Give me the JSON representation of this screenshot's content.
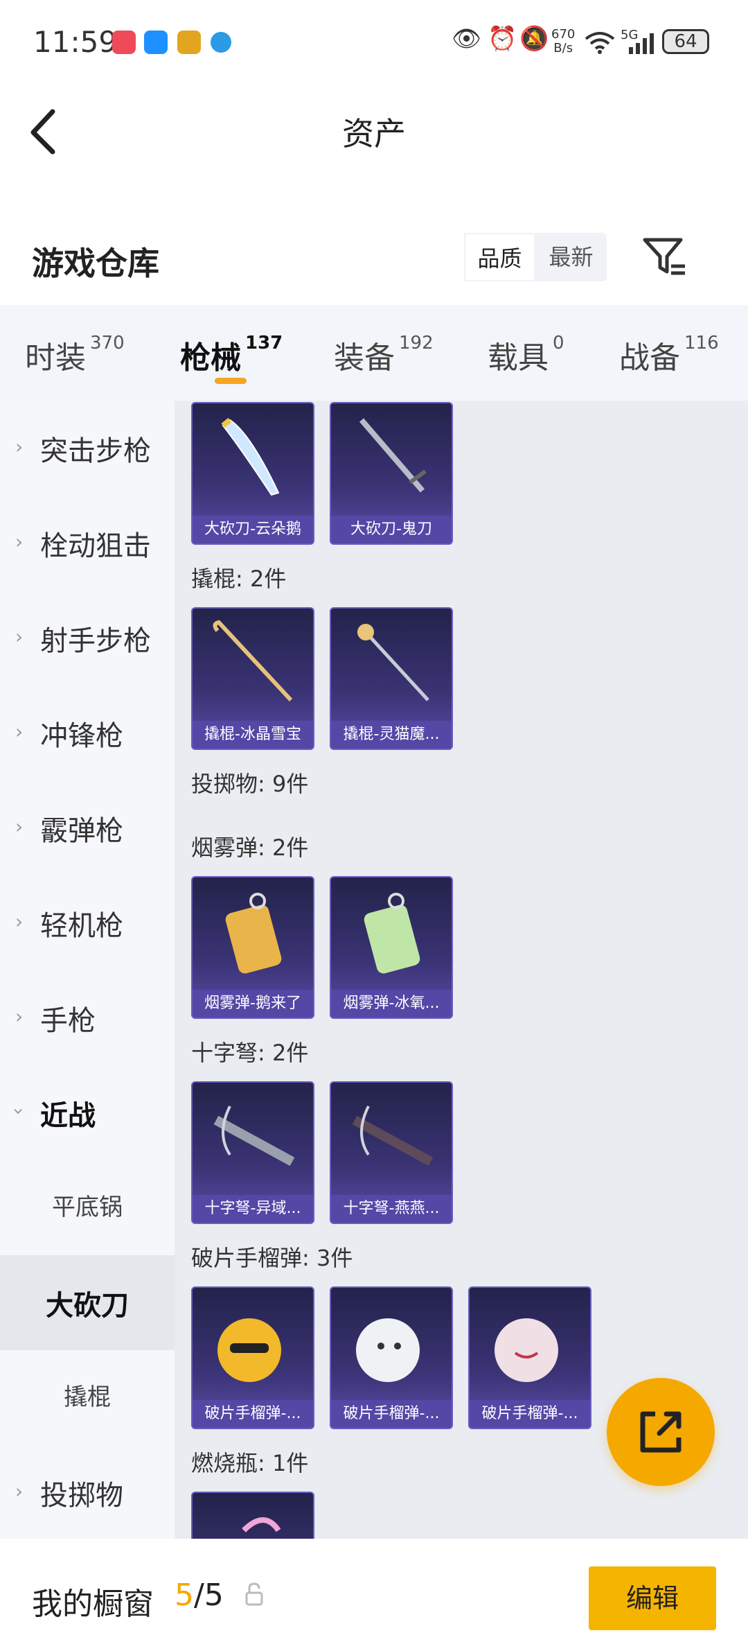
{
  "status_bar": {
    "time": "11:59",
    "net_speed_value": "670",
    "net_speed_unit": "B/s",
    "network": "5G",
    "battery": "64"
  },
  "header": {
    "title": "资产"
  },
  "warehouse": {
    "title": "游戏仓库",
    "sort_options": [
      "品质",
      "最新"
    ],
    "active_sort": "品质"
  },
  "tabs": [
    {
      "label": "时装",
      "count": "370"
    },
    {
      "label": "枪械",
      "count": "137"
    },
    {
      "label": "装备",
      "count": "192"
    },
    {
      "label": "载具",
      "count": "0"
    },
    {
      "label": "战备",
      "count": "116"
    }
  ],
  "active_tab": "枪械",
  "sidebar": {
    "items": [
      {
        "label": "突击步枪"
      },
      {
        "label": "栓动狙击"
      },
      {
        "label": "射手步枪"
      },
      {
        "label": "冲锋枪"
      },
      {
        "label": "霰弹枪"
      },
      {
        "label": "轻机枪"
      },
      {
        "label": "手枪"
      },
      {
        "label": "近战"
      },
      {
        "label": "平底锅"
      },
      {
        "label": "大砍刀"
      },
      {
        "label": "撬棍"
      },
      {
        "label": "投掷物"
      }
    ],
    "selected": "大砍刀"
  },
  "content": {
    "top_items": [
      "大砍刀-云朵鹅",
      "大砍刀-鬼刀"
    ],
    "sections": [
      {
        "title": "撬棍: 2件",
        "items": [
          "撬棍-冰晶雪宝",
          "撬棍-灵猫魔..."
        ]
      },
      {
        "title": "投掷物: 9件",
        "items": []
      },
      {
        "title": "烟雾弹: 2件",
        "items": [
          "烟雾弹-鹅来了",
          "烟雾弹-冰氧..."
        ]
      },
      {
        "title": "十字弩: 2件",
        "items": [
          "十字弩-异域...",
          "十字弩-燕燕..."
        ]
      },
      {
        "title": "破片手榴弹: 3件",
        "items": [
          "破片手榴弹-...",
          "破片手榴弹-...",
          "破片手榴弹-..."
        ]
      },
      {
        "title": "燃烧瓶: 1件",
        "items": [
          ""
        ]
      }
    ]
  },
  "bottom_bar": {
    "label": "我的橱窗",
    "current": "5",
    "separator": "/",
    "total": "5",
    "edit_label": "编辑"
  },
  "colors": {
    "accent": "#f5a800",
    "card_bg": "#3a3375",
    "card_caption": "#5447a6"
  }
}
